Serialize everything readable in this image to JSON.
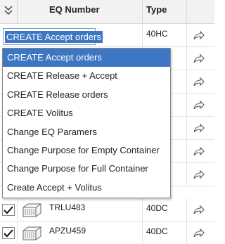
{
  "header": {
    "eq_number": "EQ Number",
    "type": "Type"
  },
  "action_select": {
    "value": "CREATE Accept orders"
  },
  "dropdown": {
    "options": [
      "CREATE Accept orders",
      "CREATE Release + Accept",
      "CREATE Release orders",
      "CREATE Volitus",
      "Change EQ Paramers",
      "Change Purpose for Empty Container",
      "Change Purpose for Full Container",
      "Create Accept + Volitus"
    ],
    "selected_index": 0
  },
  "rows": [
    {
      "eq_number": "",
      "type": "40HC"
    },
    {
      "eq_number": "",
      "type": ""
    },
    {
      "eq_number": "",
      "type": ""
    },
    {
      "eq_number": "",
      "type": ""
    },
    {
      "eq_number": "",
      "type": ""
    },
    {
      "eq_number": "",
      "type": ""
    },
    {
      "eq_number": "",
      "type": ""
    },
    {
      "eq_number": "TRLU483",
      "type": "40DC"
    },
    {
      "eq_number": "APZU459",
      "type": "40DC"
    }
  ],
  "icons": {
    "collapse": "double-chevron-down-icon",
    "share": "share-arrow-icon",
    "container": "container-icon",
    "check": "checkmark-icon"
  },
  "colors": {
    "selection_blue": "#3d77c4",
    "header_bg": "#f2f2f2"
  }
}
